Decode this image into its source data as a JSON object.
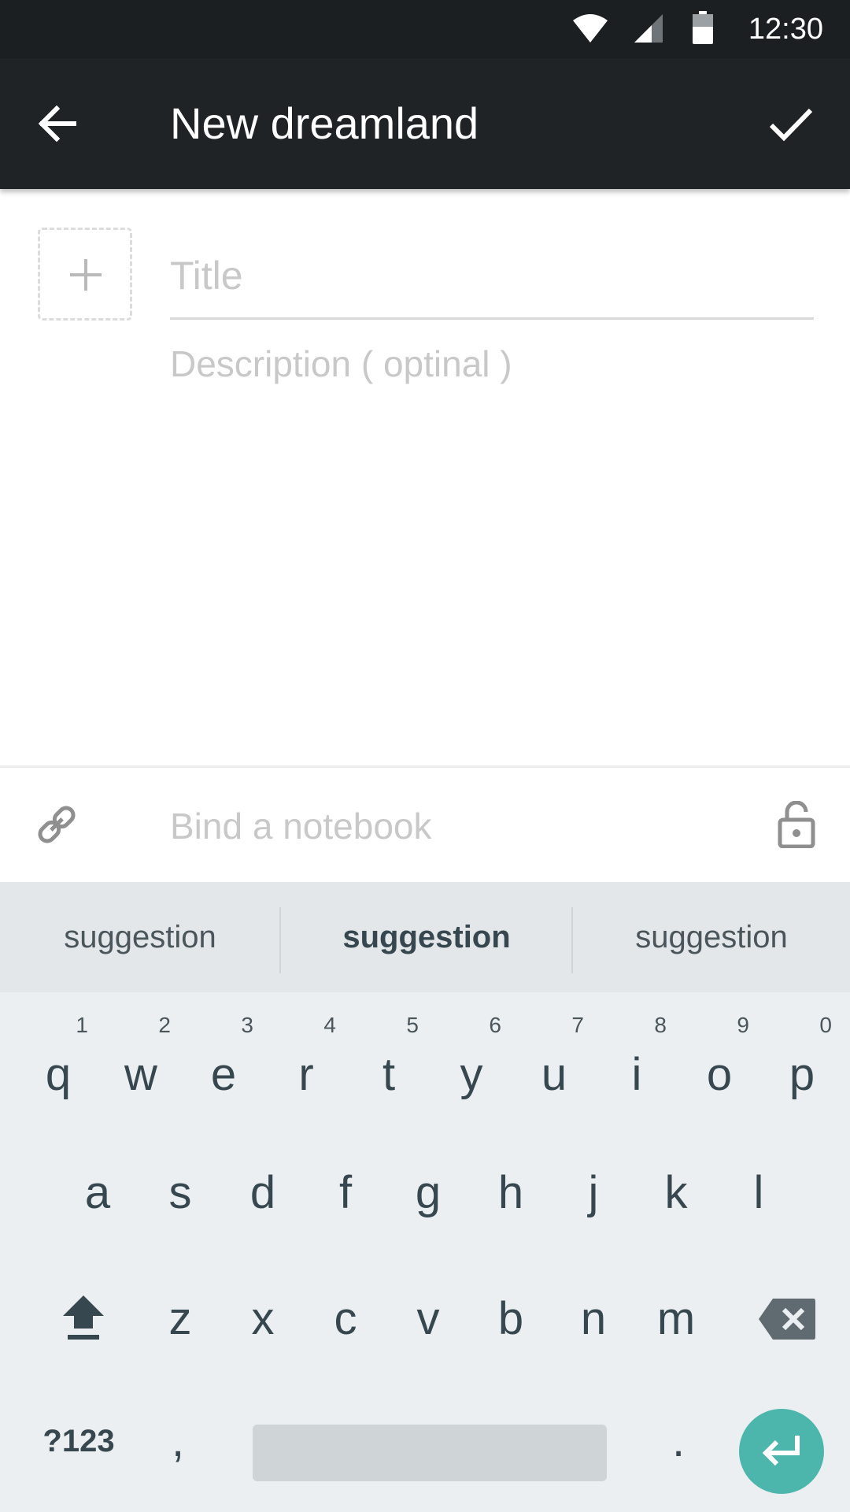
{
  "status_bar": {
    "time": "12:30",
    "icons": [
      "wifi-icon",
      "cell-signal-icon",
      "battery-icon"
    ]
  },
  "app_bar": {
    "title": "New dreamland",
    "back_icon": "arrow-back-icon",
    "confirm_icon": "check-icon"
  },
  "form": {
    "add_image_icon": "plus-icon",
    "title_placeholder": "Title",
    "title_value": "",
    "description_placeholder": "Description ( optinal )",
    "description_value": ""
  },
  "bind_row": {
    "link_icon": "link-icon",
    "label": "Bind a notebook",
    "lock_icon": "lock-open-icon"
  },
  "keyboard": {
    "suggestions": [
      "suggestion",
      "suggestion",
      "suggestion"
    ],
    "row1": [
      {
        "key": "q",
        "num": "1"
      },
      {
        "key": "w",
        "num": "2"
      },
      {
        "key": "e",
        "num": "3"
      },
      {
        "key": "r",
        "num": "4"
      },
      {
        "key": "t",
        "num": "5"
      },
      {
        "key": "y",
        "num": "6"
      },
      {
        "key": "u",
        "num": "7"
      },
      {
        "key": "i",
        "num": "8"
      },
      {
        "key": "o",
        "num": "9"
      },
      {
        "key": "p",
        "num": "0"
      }
    ],
    "row2": [
      "a",
      "s",
      "d",
      "f",
      "g",
      "h",
      "j",
      "k",
      "l"
    ],
    "row3": [
      "z",
      "x",
      "c",
      "v",
      "b",
      "n",
      "m"
    ],
    "symbols_label": "?123",
    "comma": ",",
    "period": ".",
    "accent_color": "#4db6ac"
  }
}
